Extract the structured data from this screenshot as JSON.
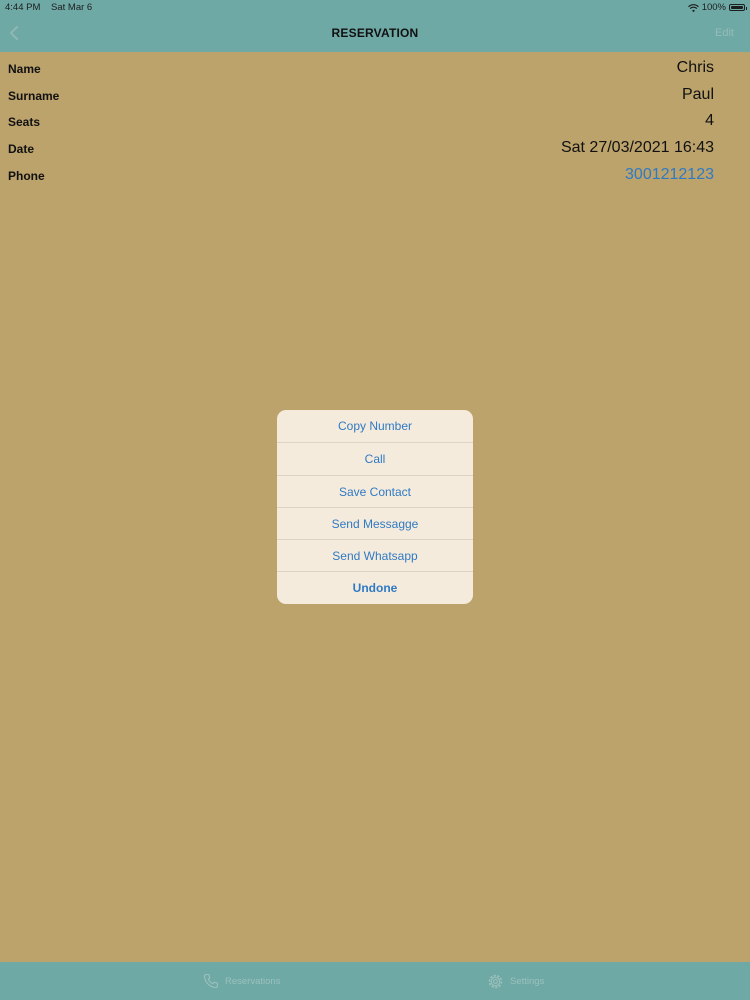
{
  "status_bar": {
    "time": "4:44 PM",
    "date": "Sat Mar 6",
    "battery": "100%"
  },
  "nav": {
    "title": "RESERVATION",
    "edit_label": "Edit"
  },
  "details": [
    {
      "label": "Name",
      "value": "Chris"
    },
    {
      "label": "Surname",
      "value": "Paul"
    },
    {
      "label": "Seats",
      "value": "4"
    },
    {
      "label": "Date",
      "value": "Sat 27/03/2021 16:43"
    },
    {
      "label": "Phone",
      "value": "3001212123"
    }
  ],
  "action_sheet": {
    "options": [
      "Copy Number",
      "Call",
      "Save Contact",
      "Send Messagge",
      "Send Whatsapp",
      "Undone"
    ]
  },
  "tab_bar": {
    "reservations_label": "Reservations",
    "settings_label": "Settings"
  },
  "colors": {
    "bar": "#6ea9a5",
    "background": "#bca26b",
    "sheet": "#f5ebdc",
    "accent": "#2f7ac4"
  },
  "icons": {
    "back": "chevron-left-icon",
    "wifi": "wifi-icon",
    "battery": "battery-icon",
    "phone": "phone-icon",
    "gear": "gear-icon"
  }
}
